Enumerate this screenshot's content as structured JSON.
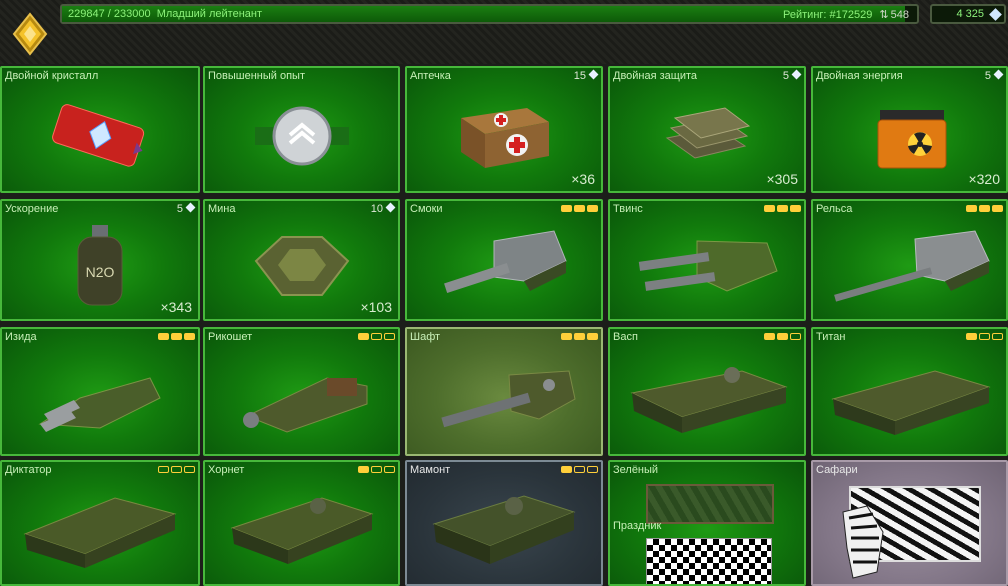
{
  "header": {
    "xp_text": "229847 / 233000",
    "rank": "Младший лейтенант",
    "xp_fraction": 0.9865,
    "rating_label": "Рейтинг: #172529",
    "rating_change": "548",
    "crystals": "4 325"
  },
  "items": [
    {
      "name": "Двойной кристалл",
      "price": "",
      "count": "",
      "stars": 0
    },
    {
      "name": "Повышенный опыт",
      "price": "",
      "count": "",
      "stars": 0
    },
    {
      "name": "Аптечка",
      "price": "15",
      "count": "×36",
      "stars": 0
    },
    {
      "name": "Двойная защита",
      "price": "5",
      "count": "×305",
      "stars": 0
    },
    {
      "name": "Двойная энергия",
      "price": "5",
      "count": "×320",
      "stars": 0
    },
    {
      "name": "Ускорение",
      "price": "5",
      "count": "×343",
      "stars": 0
    },
    {
      "name": "Мина",
      "price": "10",
      "count": "×103",
      "stars": 0
    },
    {
      "name": "Смоки",
      "price": "",
      "count": "",
      "stars": 3
    },
    {
      "name": "Твинс",
      "price": "",
      "count": "",
      "stars": 3
    },
    {
      "name": "Рельса",
      "price": "",
      "count": "",
      "stars": 3
    },
    {
      "name": "Изида",
      "price": "",
      "count": "",
      "stars": 3
    },
    {
      "name": "Рикошет",
      "price": "",
      "count": "",
      "stars": 1
    },
    {
      "name": "Шафт",
      "price": "",
      "count": "",
      "stars": 3
    },
    {
      "name": "Васп",
      "price": "",
      "count": "",
      "stars": 2
    },
    {
      "name": "Титан",
      "price": "",
      "count": "",
      "stars": 1
    },
    {
      "name": "Диктатор",
      "price": "",
      "count": "",
      "stars": 0
    },
    {
      "name": "Хорнет",
      "price": "",
      "count": "",
      "stars": 1
    },
    {
      "name": "Мамонт",
      "price": "",
      "count": "",
      "stars": 1
    },
    {
      "name": "Зелёный",
      "price": "",
      "count": "",
      "stars": 0
    },
    {
      "name": "Сафари",
      "price": "",
      "count": "",
      "stars": 0
    }
  ],
  "extra": {
    "prazdnik": "Праздник"
  },
  "icons": [
    "rank-icon",
    "crystal-icon",
    "rating-arrows-icon"
  ]
}
